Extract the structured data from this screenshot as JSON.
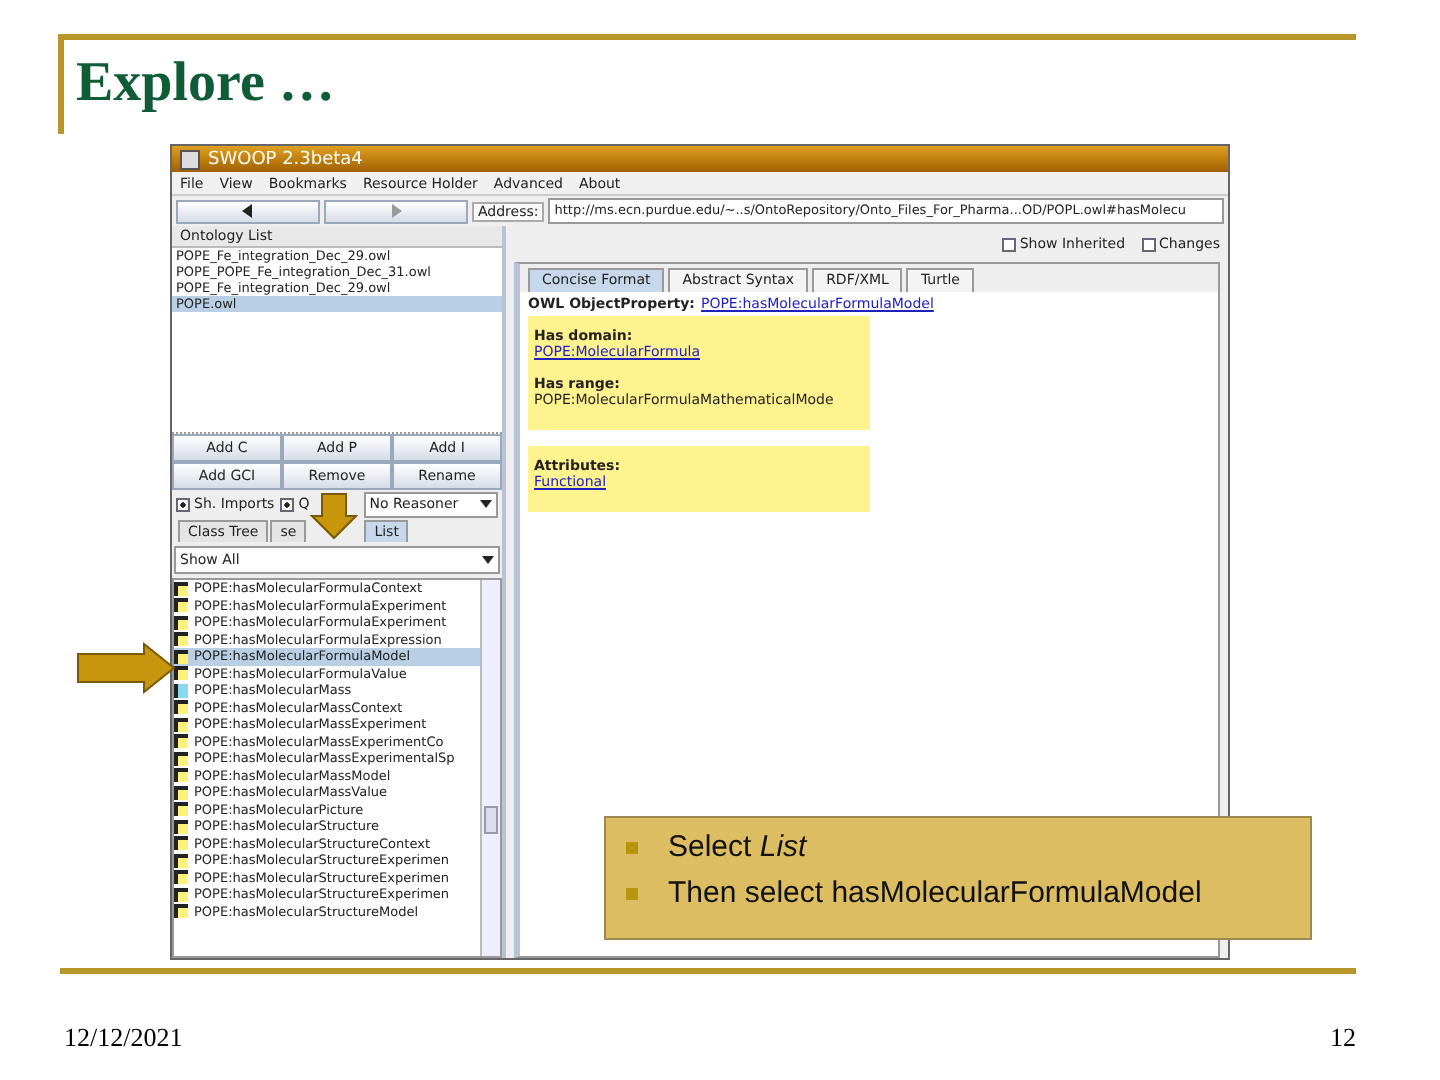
{
  "slide": {
    "title": "Explore …",
    "date": "12/12/2021",
    "page_number": "12"
  },
  "app": {
    "window_title": "SWOOP 2.3beta4",
    "menu": [
      "File",
      "View",
      "Bookmarks",
      "Resource Holder",
      "Advanced",
      "About"
    ],
    "address_label": "Address:",
    "address": "http://ms.ecn.purdue.edu/~..s/OntoRepository/Onto_Files_For_Pharma...OD/POPL.owl#hasMolecu",
    "ontology_list": {
      "title": "Ontology List",
      "items": [
        {
          "label": "POPE_Fe_integration_Dec_29.owl",
          "selected": false
        },
        {
          "label": "POPE_POPE_Fe_integration_Dec_31.owl",
          "selected": false
        },
        {
          "label": "POPE_Fe_integration_Dec_29.owl",
          "selected": false
        },
        {
          "label": "POPE.owl",
          "selected": true
        }
      ]
    },
    "entity_buttons": [
      "Add C",
      "Add P",
      "Add I",
      "Add GCI",
      "Remove",
      "Rename"
    ],
    "options": [
      {
        "label": "Sh. Imports",
        "checked": true
      },
      {
        "label": "Q",
        "checked": true
      }
    ],
    "reasoner": "No Reasoner",
    "tree_tabs": [
      {
        "label": "Class Tree",
        "selected": false
      },
      {
        "label": "se",
        "selected": false
      },
      {
        "label": "List",
        "selected": true
      }
    ],
    "filter": "Show All",
    "entities": [
      {
        "label": "POPE:hasMolecularFormulaContext",
        "kind": "functional",
        "selected": false
      },
      {
        "label": "POPE:hasMolecularFormulaExperiment",
        "kind": "functional",
        "selected": false
      },
      {
        "label": "POPE:hasMolecularFormulaExperiment",
        "kind": "functional",
        "selected": false
      },
      {
        "label": "POPE:hasMolecularFormulaExpression",
        "kind": "functional",
        "selected": false
      },
      {
        "label": "POPE:hasMolecularFormulaModel",
        "kind": "functional",
        "selected": true
      },
      {
        "label": "POPE:hasMolecularFormulaValue",
        "kind": "functional",
        "selected": false
      },
      {
        "label": "POPE:hasMolecularMass",
        "kind": "object",
        "selected": false
      },
      {
        "label": "POPE:hasMolecularMassContext",
        "kind": "functional",
        "selected": false
      },
      {
        "label": "POPE:hasMolecularMassExperiment",
        "kind": "functional",
        "selected": false
      },
      {
        "label": "POPE:hasMolecularMassExperimentCo",
        "kind": "functional",
        "selected": false
      },
      {
        "label": "POPE:hasMolecularMassExperimentalSp",
        "kind": "functional",
        "selected": false
      },
      {
        "label": "POPE:hasMolecularMassModel",
        "kind": "functional",
        "selected": false
      },
      {
        "label": "POPE:hasMolecularMassValue",
        "kind": "functional",
        "selected": false
      },
      {
        "label": "POPE:hasMolecularPicture",
        "kind": "functional",
        "selected": false
      },
      {
        "label": "POPE:hasMolecularStructure",
        "kind": "functional",
        "selected": false
      },
      {
        "label": "POPE:hasMolecularStructureContext",
        "kind": "functional",
        "selected": false
      },
      {
        "label": "POPE:hasMolecularStructureExperimen",
        "kind": "functional",
        "selected": false
      },
      {
        "label": "POPE:hasMolecularStructureExperimen",
        "kind": "functional",
        "selected": false
      },
      {
        "label": "POPE:hasMolecularStructureExperimen",
        "kind": "functional",
        "selected": false
      },
      {
        "label": "POPE:hasMolecularStructureModel",
        "kind": "functional",
        "selected": false
      }
    ],
    "view_options": [
      {
        "label": "Show Inherited",
        "checked": false
      },
      {
        "label": "Changes",
        "checked": false
      }
    ],
    "view_tabs": [
      {
        "label": "Concise Format",
        "selected": true
      },
      {
        "label": "Abstract Syntax",
        "selected": false
      },
      {
        "label": "RDF/XML",
        "selected": false
      },
      {
        "label": "Turtle",
        "selected": false
      }
    ],
    "property": {
      "heading": "OWL ObjectProperty:",
      "name": "POPE:hasMolecularFormulaModel"
    },
    "sections": [
      {
        "blocks": [
          {
            "label": "Has domain:",
            "value": "POPE:MolecularFormula",
            "link": true
          },
          {
            "label": "Has range:",
            "value": "POPE:MolecularFormulaMathematicalMode",
            "link": false
          }
        ]
      },
      {
        "blocks": [
          {
            "label": "Attributes:",
            "value": "Functional",
            "link": true
          }
        ]
      }
    ]
  },
  "callout": {
    "bullets": [
      "Select *List*",
      "Then select hasMolecularFormulaModel"
    ]
  }
}
